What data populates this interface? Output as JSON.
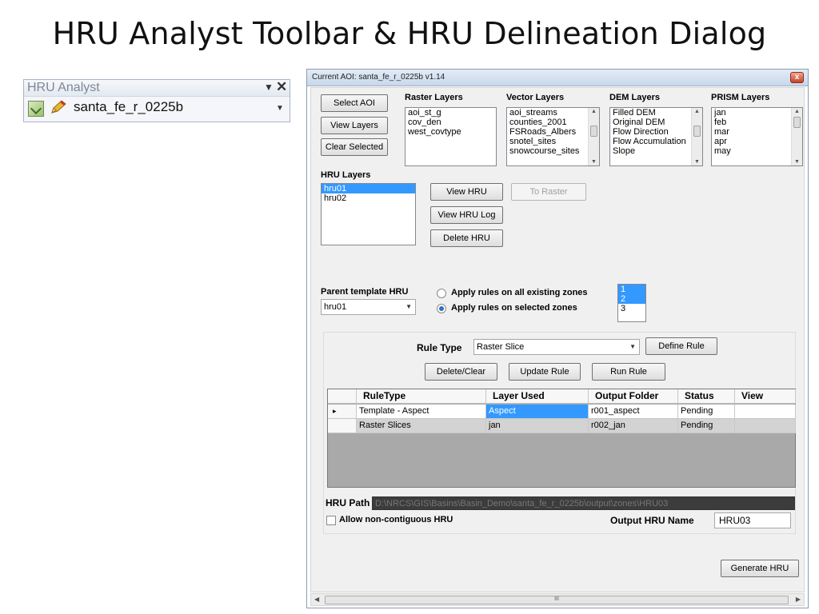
{
  "slide": {
    "title": "HRU Analyst Toolbar & HRU Delineation Dialog"
  },
  "toolbar": {
    "title": "HRU Analyst",
    "dropdown_glyph": "▼",
    "close_glyph": "✕",
    "aoi_name": "santa_fe_r_0225b",
    "aoi_dropdown_glyph": "▼",
    "icons": [
      "map-tool-icon",
      "pencil-edit-icon"
    ]
  },
  "dialog": {
    "title": "Current AOI: santa_fe_r_0225b v1.14",
    "close_glyph": "x",
    "buttons": {
      "select_aoi": "Select AOI",
      "view_layers": "View Layers",
      "clear_selected": "Clear Selected",
      "view_hru": "View HRU",
      "to_raster": "To Raster",
      "view_hru_log": "View HRU Log",
      "delete_hru": "Delete HRU",
      "define_rule": "Define Rule",
      "delete_clear": "Delete/Clear",
      "update_rule": "Update Rule",
      "run_rule": "Run Rule",
      "generate_hru": "Generate HRU"
    },
    "raster_layers": {
      "label": "Raster Layers",
      "items": [
        "aoi_st_g",
        "cov_den",
        "west_covtype"
      ]
    },
    "vector_layers": {
      "label": "Vector Layers",
      "items": [
        "aoi_streams",
        "counties_2001",
        "FSRoads_Albers",
        "snotel_sites",
        "snowcourse_sites"
      ]
    },
    "dem_layers": {
      "label": "DEM Layers",
      "items": [
        "Filled DEM",
        "Original DEM",
        "Flow Direction",
        "Flow Accumulation",
        "Slope"
      ]
    },
    "prism_layers": {
      "label": "PRISM Layers",
      "items": [
        "jan",
        "feb",
        "mar",
        "apr",
        "may"
      ]
    },
    "hru_layers": {
      "label": "HRU Layers",
      "items": [
        "hru01",
        "hru02"
      ],
      "selected": "hru01"
    },
    "parent_template": {
      "label": "Parent template HRU",
      "value": "hru01",
      "radio_all": "Apply rules on all existing zones",
      "radio_selected": "Apply rules on selected zones",
      "selected_option": "Apply rules on selected zones",
      "zones": [
        "1",
        "2",
        "3"
      ],
      "selected_zones": [
        "1",
        "2"
      ]
    },
    "rule": {
      "type_label": "Rule Type",
      "type_value": "Raster Slice",
      "columns": [
        "RuleType",
        "Layer Used",
        "Output Folder",
        "Status",
        "View"
      ],
      "rows": [
        {
          "marker": "▸",
          "rule_type": "Template - Aspect",
          "layer_used": "Aspect",
          "output_folder": "r001_aspect",
          "status": "Pending",
          "view": ""
        },
        {
          "marker": "",
          "rule_type": "Raster Slices",
          "layer_used": "jan",
          "output_folder": "r002_jan",
          "status": "Pending",
          "view": ""
        }
      ]
    },
    "hru_path": {
      "label": "HRU Path",
      "value": "D:\\NRCS\\GIS\\Basins\\Basin_Demo\\santa_fe_r_0225b\\output\\zones\\HRU03"
    },
    "allow_noncontiguous": {
      "label": "Allow non-contiguous HRU",
      "checked": false
    },
    "output_name": {
      "label": "Output HRU Name",
      "value": "HRU03"
    },
    "hscroll_grip": "III"
  }
}
